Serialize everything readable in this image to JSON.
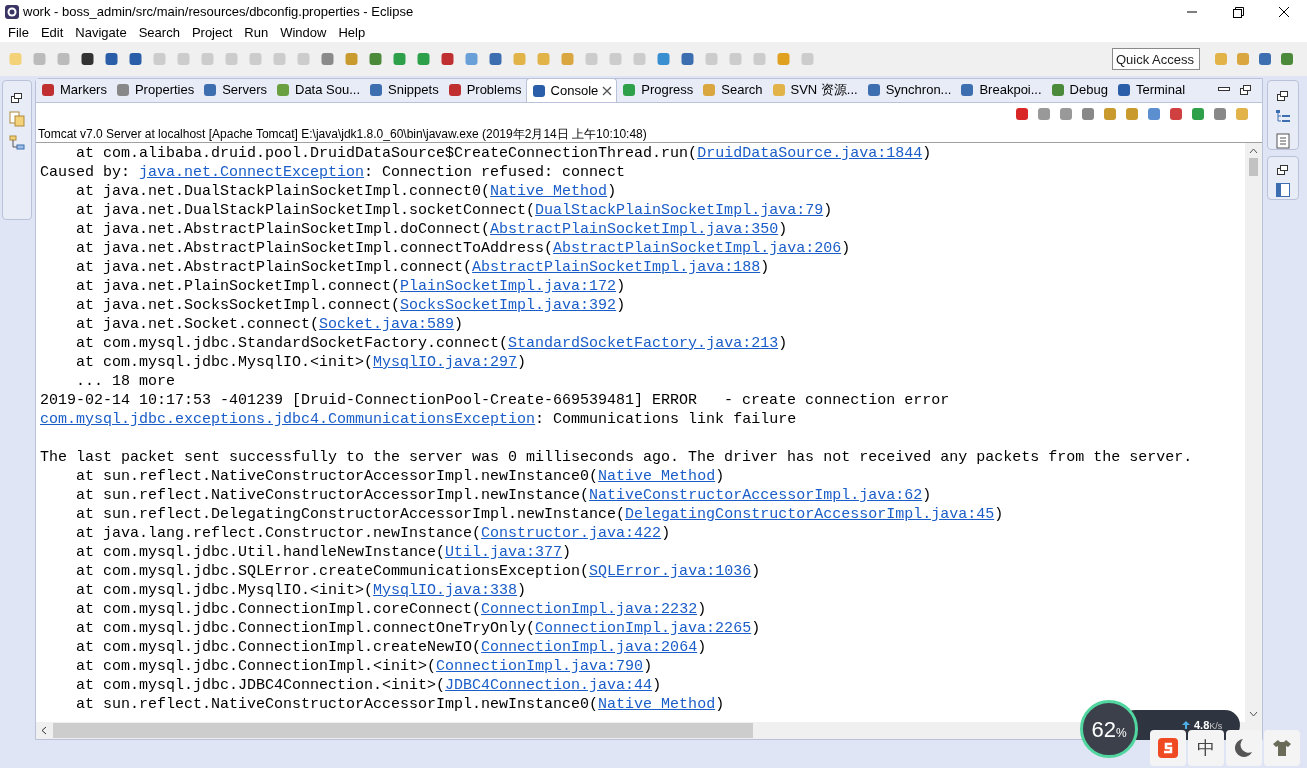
{
  "window": {
    "title": "work - boss_admin/src/main/resources/dbconfig.properties - Eclipse"
  },
  "menu": [
    "File",
    "Edit",
    "Navigate",
    "Search",
    "Project",
    "Run",
    "Window",
    "Help"
  ],
  "quick_access": {
    "placeholder": "Quick Access"
  },
  "tabs": [
    {
      "label": "Markers",
      "selected": false
    },
    {
      "label": "Properties",
      "selected": false
    },
    {
      "label": "Servers",
      "selected": false
    },
    {
      "label": "Data Sou...",
      "selected": false
    },
    {
      "label": "Snippets",
      "selected": false
    },
    {
      "label": "Problems",
      "selected": false
    },
    {
      "label": "Console",
      "selected": true
    },
    {
      "label": "Progress",
      "selected": false
    },
    {
      "label": "Search",
      "selected": false
    },
    {
      "label": "SVN 资源...",
      "selected": false
    },
    {
      "label": "Synchron...",
      "selected": false
    },
    {
      "label": "Breakpoi...",
      "selected": false
    },
    {
      "label": "Debug",
      "selected": false
    },
    {
      "label": "Terminal",
      "selected": false
    }
  ],
  "console": {
    "header": "Tomcat v7.0 Server at localhost [Apache Tomcat] E:\\java\\jdk1.8.0_60\\bin\\javaw.exe (2019年2月14日 上午10:10:48)",
    "lines": [
      {
        "kind": "text",
        "pre": "\tat com.alibaba.druid.pool.DruidDataSource$CreateConnectionThread.run(",
        "link": "DruidDataSource.java:1844",
        "post": ")"
      },
      {
        "kind": "text",
        "pre": "Caused by: ",
        "link": "java.net.ConnectException",
        "post": ": Connection refused: connect"
      },
      {
        "kind": "text",
        "pre": "\tat java.net.DualStackPlainSocketImpl.connect0(",
        "link": "Native Method",
        "post": ")"
      },
      {
        "kind": "text",
        "pre": "\tat java.net.DualStackPlainSocketImpl.socketConnect(",
        "link": "DualStackPlainSocketImpl.java:79",
        "post": ")"
      },
      {
        "kind": "text",
        "pre": "\tat java.net.AbstractPlainSocketImpl.doConnect(",
        "link": "AbstractPlainSocketImpl.java:350",
        "post": ")"
      },
      {
        "kind": "text",
        "pre": "\tat java.net.AbstractPlainSocketImpl.connectToAddress(",
        "link": "AbstractPlainSocketImpl.java:206",
        "post": ")"
      },
      {
        "kind": "text",
        "pre": "\tat java.net.AbstractPlainSocketImpl.connect(",
        "link": "AbstractPlainSocketImpl.java:188",
        "post": ")"
      },
      {
        "kind": "text",
        "pre": "\tat java.net.PlainSocketImpl.connect(",
        "link": "PlainSocketImpl.java:172",
        "post": ")"
      },
      {
        "kind": "text",
        "pre": "\tat java.net.SocksSocketImpl.connect(",
        "link": "SocksSocketImpl.java:392",
        "post": ")"
      },
      {
        "kind": "text",
        "pre": "\tat java.net.Socket.connect(",
        "link": "Socket.java:589",
        "post": ")"
      },
      {
        "kind": "text",
        "pre": "\tat com.mysql.jdbc.StandardSocketFactory.connect(",
        "link": "StandardSocketFactory.java:213",
        "post": ")"
      },
      {
        "kind": "text",
        "pre": "\tat com.mysql.jdbc.MysqlIO.<init>(",
        "link": "MysqlIO.java:297",
        "post": ")"
      },
      {
        "kind": "text",
        "pre": "\t... 18 more"
      },
      {
        "kind": "text",
        "pre": "2019-02-14 10:17:53 -401239 [Druid-ConnectionPool-Create-669539481] ERROR   - create connection error"
      },
      {
        "kind": "text",
        "link": "com.mysql.jdbc.exceptions.jdbc4.CommunicationsException",
        "post": ": Communications link failure"
      },
      {
        "kind": "blank"
      },
      {
        "kind": "text",
        "pre": "The last packet sent successfully to the server was 0 milliseconds ago. The driver has not received any packets from the server."
      },
      {
        "kind": "text",
        "pre": "\tat sun.reflect.NativeConstructorAccessorImpl.newInstance0(",
        "link": "Native Method",
        "post": ")"
      },
      {
        "kind": "text",
        "pre": "\tat sun.reflect.NativeConstructorAccessorImpl.newInstance(",
        "link": "NativeConstructorAccessorImpl.java:62",
        "post": ")"
      },
      {
        "kind": "text",
        "pre": "\tat sun.reflect.DelegatingConstructorAccessorImpl.newInstance(",
        "link": "DelegatingConstructorAccessorImpl.java:45",
        "post": ")"
      },
      {
        "kind": "text",
        "pre": "\tat java.lang.reflect.Constructor.newInstance(",
        "link": "Constructor.java:422",
        "post": ")"
      },
      {
        "kind": "text",
        "pre": "\tat com.mysql.jdbc.Util.handleNewInstance(",
        "link": "Util.java:377",
        "post": ")"
      },
      {
        "kind": "text",
        "pre": "\tat com.mysql.jdbc.SQLError.createCommunicationsException(",
        "link": "SQLError.java:1036",
        "post": ")"
      },
      {
        "kind": "text",
        "pre": "\tat com.mysql.jdbc.MysqlIO.<init>(",
        "link": "MysqlIO.java:338",
        "post": ")"
      },
      {
        "kind": "text",
        "pre": "\tat com.mysql.jdbc.ConnectionImpl.coreConnect(",
        "link": "ConnectionImpl.java:2232",
        "post": ")"
      },
      {
        "kind": "text",
        "pre": "\tat com.mysql.jdbc.ConnectionImpl.connectOneTryOnly(",
        "link": "ConnectionImpl.java:2265",
        "post": ")"
      },
      {
        "kind": "text",
        "pre": "\tat com.mysql.jdbc.ConnectionImpl.createNewIO(",
        "link": "ConnectionImpl.java:2064",
        "post": ")"
      },
      {
        "kind": "text",
        "pre": "\tat com.mysql.jdbc.ConnectionImpl.<init>(",
        "link": "ConnectionImpl.java:790",
        "post": ")"
      },
      {
        "kind": "text",
        "pre": "\tat com.mysql.jdbc.JDBC4Connection.<init>(",
        "link": "JDBC4Connection.java:44",
        "post": ")"
      },
      {
        "kind": "text",
        "pre": "\tat sun.reflect.NativeConstructorAccessorImpl.newInstance0(",
        "link": "Native Method",
        "post": ")"
      }
    ]
  },
  "overlay": {
    "percent": "62",
    "percent_unit": "%",
    "upload": "4.8",
    "upload_unit": "K/s",
    "ime_label": "中"
  }
}
